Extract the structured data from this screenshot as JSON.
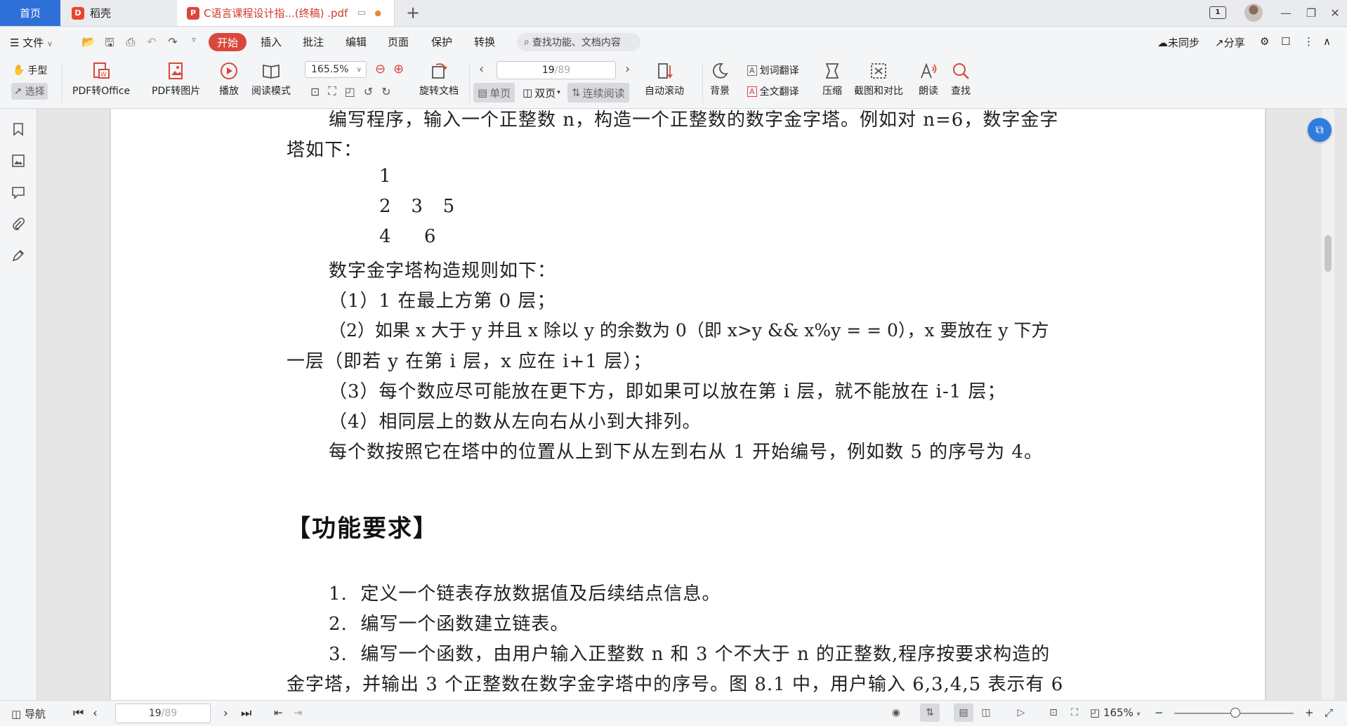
{
  "tabs": {
    "home": "首页",
    "daoke": "稻壳",
    "document": "C语言课程设计指...(终稿) .pdf",
    "add": "+"
  },
  "window": {
    "badge": "1",
    "minimize": "—",
    "restore": "❐",
    "close": "✕"
  },
  "menu": {
    "file": "文件",
    "tabs": [
      "开始",
      "插入",
      "批注",
      "编辑",
      "页面",
      "保护",
      "转换"
    ],
    "search_placeholder": "查找功能、文档内容",
    "sync": "未同步",
    "share": "分享"
  },
  "ribbon": {
    "hand": "手型",
    "select": "选择",
    "pdf_to_office": "PDF转Office",
    "pdf_to_image": "PDF转图片",
    "play": "播放",
    "read_mode": "阅读模式",
    "zoom": "165.5%",
    "rotate": "旋转文档",
    "page_current": "19",
    "page_total": "/89",
    "single_page": "单页",
    "double_page": "双页",
    "continuous": "连续阅读",
    "auto_scroll": "自动滚动",
    "background": "背景",
    "word_translate": "划词翻译",
    "full_translate": "全文翻译",
    "compress": "压缩",
    "screenshot_compare": "截图和对比",
    "read_aloud": "朗读",
    "find": "查找"
  },
  "document": {
    "lines": [
      "编写程序，输入一个正整数 n，构造一个正整数的数字金字塔。例如对 n=6，数字金字",
      "塔如下：",
      "1",
      "2   3   5",
      "4     6",
      "数字金字塔构造规则如下：",
      "（1）1 在最上方第 0 层；",
      "（2）如果 x 大于 y 并且 x 除以 y 的余数为 0（即 x>y && x%y = = 0），x 要放在 y 下方",
      "一层（即若 y 在第 i 层，x 应在 i+1 层）；",
      "（3）每个数应尽可能放在更下方，即如果可以放在第 i 层，就不能放在 i-1 层；",
      "（4）相同层上的数从左向右从小到大排列。",
      "每个数按照它在塔中的位置从上到下从左到右从 1 开始编号，例如数 5 的序号为 4。"
    ],
    "heading": "【功能要求】",
    "requirements": [
      "1.  定义一个链表存放数据值及后续结点信息。",
      "2.  编写一个函数建立链表。",
      "3.  编写一个函数，由用户输入正整数 n 和 3 个不大于 n 的正整数,程序按要求构造的",
      "金字塔，并输出 3 个正整数在数字金字塔中的序号。图 8.1 中，用户输入 6,3,4,5 表示有 6"
    ]
  },
  "status": {
    "nav": "导航",
    "page_current": "19",
    "page_total": "/89",
    "zoom": "165%"
  },
  "colors": {
    "accent_red": "#d9473b",
    "home_tab_blue": "#2f6fd8",
    "float_button": "#2f7be0"
  }
}
